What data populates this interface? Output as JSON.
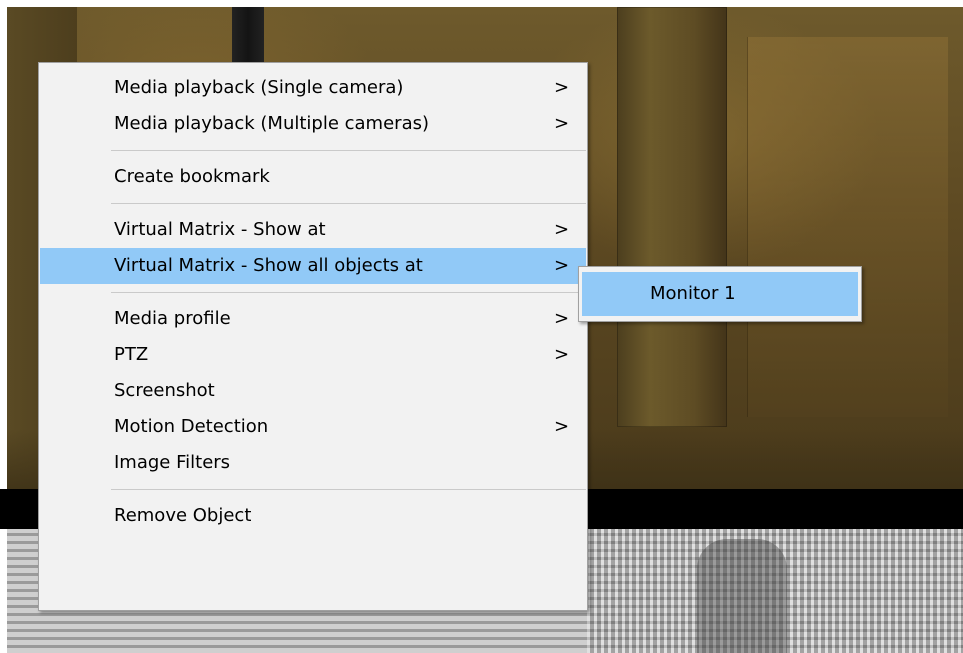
{
  "context_menu": {
    "items": [
      {
        "label": "Media playback (Single camera)",
        "arrow": ">"
      },
      {
        "label": "Media playback (Multiple cameras)",
        "arrow": ">"
      },
      {
        "label": "Create bookmark"
      },
      {
        "label": "Virtual Matrix - Show at",
        "arrow": ">"
      },
      {
        "label": "Virtual Matrix - Show all objects at",
        "arrow": ">",
        "highlighted": true
      },
      {
        "label": "Media profile",
        "arrow": ">"
      },
      {
        "label": "PTZ",
        "arrow": ">"
      },
      {
        "label": "Screenshot"
      },
      {
        "label": "Motion Detection",
        "arrow": ">"
      },
      {
        "label": "Image Filters"
      },
      {
        "label": "Remove Object"
      }
    ]
  },
  "submenu": {
    "items": [
      {
        "label": "Monitor 1",
        "highlighted": true
      }
    ]
  },
  "colors": {
    "menu_background": "#f2f2f2",
    "highlight": "#91c9f7",
    "menu_border": "#a0a0a0"
  }
}
